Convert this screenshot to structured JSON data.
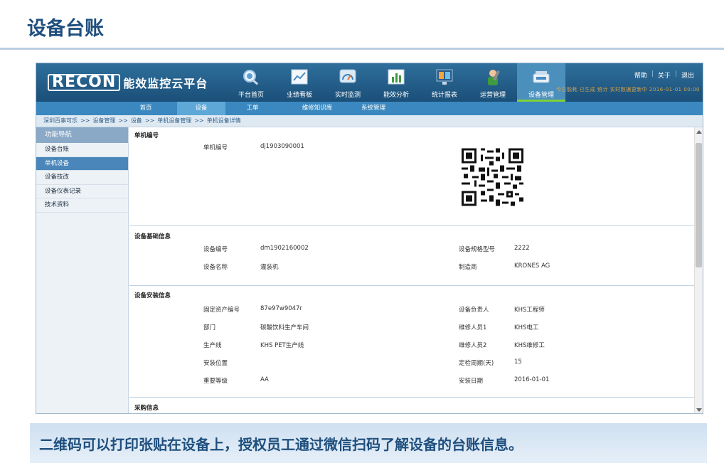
{
  "slide": {
    "title": "设备台账",
    "caption": "二维码可以打印张贴在设备上，授权员工通过微信扫码了解设备的台账信息。"
  },
  "app": {
    "logo_mark": "RECON",
    "logo_name": "能效监控云平台",
    "nav": [
      {
        "label": "平台首页",
        "icon": "magnifier-icon"
      },
      {
        "label": "业绩看板",
        "icon": "chart-board-icon"
      },
      {
        "label": "实时监测",
        "icon": "monitor-gauge-icon"
      },
      {
        "label": "能效分析",
        "icon": "bar-chart-icon"
      },
      {
        "label": "统计报表",
        "icon": "report-screen-icon"
      },
      {
        "label": "运营管理",
        "icon": "worker-icon"
      },
      {
        "label": "设备管理",
        "icon": "device-icon"
      }
    ],
    "active_nav": "设备管理",
    "top_links": {
      "help": "帮助",
      "about": "关于",
      "logout": "退出"
    },
    "ticker": "今日能耗 已生成 统计 实时数据更新中 2016-01-01 00:00",
    "subnav": [
      "首页",
      "设备",
      "工单",
      "维修知识库",
      "系统管理"
    ],
    "active_sub": "设备",
    "breadcrumb": [
      "深圳百事可乐",
      "设备管理",
      "设备",
      "单机设备管理",
      "单机设备详情"
    ],
    "breadcrumb_sep": ">>",
    "sidebar": {
      "title": "功能导航",
      "items": [
        "设备台账",
        "单机设备",
        "设备技改",
        "设备仪表记录",
        "技术资料"
      ],
      "active": "单机设备"
    },
    "detail": {
      "s1": {
        "title": "单机编号",
        "label": "单机编号",
        "value": "dj1903090001"
      },
      "s2": {
        "title": "设备基础信息",
        "rows": [
          {
            "l1": "设备编号",
            "v1": "dm1902160002",
            "l2": "设备规格型号",
            "v2": "2222"
          },
          {
            "l1": "设备名称",
            "v1": "灌装机",
            "l2": "制造商",
            "v2": "KRONES AG"
          }
        ]
      },
      "s3": {
        "title": "设备安装信息",
        "rows": [
          {
            "l1": "固定资产编号",
            "v1": "87e97w9047r",
            "l2": "设备负责人",
            "v2": "KHS工程师"
          },
          {
            "l1": "部门",
            "v1": "碳酸饮料生产车间",
            "l2": "维修人员1",
            "v2": "KHS电工"
          },
          {
            "l1": "生产线",
            "v1": "KHS PET生产线",
            "l2": "维修人员2",
            "v2": "KHS维修工"
          },
          {
            "l1": "安装位置",
            "v1": "",
            "l2": "定检周期(天)",
            "v2": "15"
          },
          {
            "l1": "重要等级",
            "v1": "AA",
            "l2": "安装日期",
            "v2": "2016-01-01"
          }
        ]
      },
      "s4": {
        "title": "采购信息"
      }
    }
  }
}
